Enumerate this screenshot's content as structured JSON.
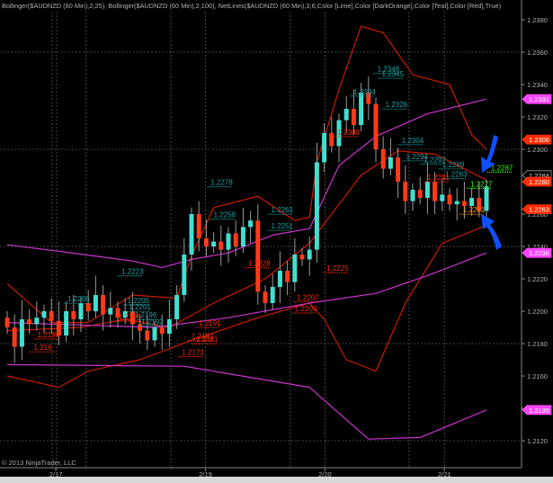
{
  "title": "Bollinger($AUDNZD (60 Min),2,25), Bollinger($AUDNZD (60 Min),2,100), NetLines($AUDNZD (60 Min),3,6,Color [Lime],Color [DarkOrange],Color [Teal],Color [Red],True)",
  "copyright": "© 2013 NinjaTrader, LLC",
  "chart_data": {
    "type": "candlestick",
    "instrument": "$AUDNZD (60 Min)",
    "ylim": [
      1.211,
      1.239
    ],
    "y_ticks": [
      "1.2380",
      "1.2360",
      "1.2340",
      "1.2320",
      "1.2300",
      "1.2280",
      "1.2260",
      "1.2240",
      "1.2220",
      "1.2200",
      "1.2180",
      "1.2160",
      "1.2140",
      "1.2120"
    ],
    "grid_prices": [
      1.236,
      1.23,
      1.224,
      1.218,
      1.212
    ],
    "x_labels": [
      {
        "text": "2/17",
        "bar": 6.6
      },
      {
        "text": "2/19",
        "bar": 26.9
      },
      {
        "text": "2/20",
        "bar": 43.1
      },
      {
        "text": "2/21",
        "bar": 59.3
      }
    ],
    "session_bars": [
      6.1,
      6.7,
      10.7,
      22.2,
      26.9,
      38.4,
      43.1,
      54.5,
      59.3
    ],
    "closes": [
      1.219,
      1.2178,
      1.2195,
      1.2192,
      1.2196,
      1.22,
      1.2194,
      1.2185,
      1.22,
      1.2195,
      1.2205,
      1.22,
      1.221,
      1.2198,
      1.2202,
      1.2196,
      1.22,
      1.2192,
      1.2188,
      1.2182,
      1.219,
      1.2186,
      1.2195,
      1.221,
      1.2235,
      1.226,
      1.2245,
      1.224,
      1.2243,
      1.2238,
      1.2248,
      1.224,
      1.2252,
      1.2256,
      1.2212,
      1.2205,
      1.2215,
      1.2225,
      1.2218,
      1.2235,
      1.2232,
      1.2238,
      1.2292,
      1.231,
      1.2302,
      1.2318,
      1.2325,
      1.2315,
      1.2335,
      1.2328,
      1.23,
      1.2288,
      1.2295,
      1.228,
      1.2268,
      1.2275,
      1.227,
      1.228,
      1.2268,
      1.2272,
      1.2266,
      1.2268,
      1.2265,
      1.227,
      1.2262,
      1.2277
    ],
    "first_open": 1.2196,
    "series": [
      {
        "name": "Bollinger 25 Upper",
        "color": "#cc1a00",
        "points": [
          [
            0,
            1.2217
          ],
          [
            6,
            1.2193
          ],
          [
            11,
            1.2193
          ],
          [
            17,
            1.221
          ],
          [
            23,
            1.2208
          ],
          [
            25,
            1.2234
          ],
          [
            28,
            1.2264
          ],
          [
            34,
            1.2271
          ],
          [
            39,
            1.2256
          ],
          [
            41,
            1.2258
          ],
          [
            42,
            1.2292
          ],
          [
            45,
            1.2337
          ],
          [
            48,
            1.2376
          ],
          [
            51,
            1.2372
          ],
          [
            55,
            1.2346
          ],
          [
            60,
            1.234
          ],
          [
            63,
            1.2309
          ],
          [
            65,
            1.23
          ]
        ]
      },
      {
        "name": "Bollinger 25 Middle",
        "color": "#cc1a00",
        "points": [
          [
            0,
            1.2188
          ],
          [
            10,
            1.219
          ],
          [
            16,
            1.2195
          ],
          [
            22,
            1.219
          ],
          [
            28,
            1.2205
          ],
          [
            35,
            1.222
          ],
          [
            41,
            1.2242
          ],
          [
            48,
            1.2284
          ],
          [
            53,
            1.2299
          ],
          [
            58,
            1.2297
          ],
          [
            65,
            1.2281
          ]
        ]
      },
      {
        "name": "Bollinger 25 Lower",
        "color": "#cc1a00",
        "points": [
          [
            0,
            1.216
          ],
          [
            7,
            1.2153
          ],
          [
            11,
            1.2163
          ],
          [
            18,
            1.217
          ],
          [
            25,
            1.2182
          ],
          [
            34,
            1.2196
          ],
          [
            41,
            1.2205
          ],
          [
            43,
            1.2195
          ],
          [
            46,
            1.217
          ],
          [
            50,
            1.2163
          ],
          [
            54,
            1.2205
          ],
          [
            59,
            1.2242
          ],
          [
            65,
            1.2253
          ]
        ]
      },
      {
        "name": "Bollinger 100 Upper",
        "color": "#cc33cc",
        "points": [
          [
            0,
            1.2241
          ],
          [
            7,
            1.2237
          ],
          [
            17,
            1.2231
          ],
          [
            21,
            1.2227
          ],
          [
            25,
            1.2232
          ],
          [
            30,
            1.2236
          ],
          [
            36,
            1.2247
          ],
          [
            41,
            1.2251
          ],
          [
            45,
            1.229
          ],
          [
            50,
            1.2308
          ],
          [
            57,
            1.2322
          ],
          [
            65,
            1.2331
          ]
        ]
      },
      {
        "name": "Bollinger 100 Middle",
        "color": "#cc33cc",
        "points": [
          [
            0,
            1.2193
          ],
          [
            20,
            1.219
          ],
          [
            30,
            1.2196
          ],
          [
            41,
            1.2205
          ],
          [
            50,
            1.2211
          ],
          [
            57,
            1.2222
          ],
          [
            65,
            1.2236
          ]
        ]
      },
      {
        "name": "Bollinger 100 Lower",
        "color": "#cc33cc",
        "points": [
          [
            0,
            1.2167
          ],
          [
            24,
            1.2166
          ],
          [
            41,
            1.2153
          ],
          [
            49,
            1.2121
          ],
          [
            56,
            1.2122
          ],
          [
            65,
            1.2139
          ]
        ]
      }
    ],
    "net_lines": [
      {
        "text": "1.2348",
        "price": 1.2348,
        "bar": 50.2,
        "color": "#20a0a0"
      },
      {
        "text": "1.2345",
        "price": 1.2345,
        "bar": 50.8,
        "color": "#20a0a0"
      },
      {
        "text": "1.2334",
        "price": 1.2334,
        "bar": 47.0,
        "color": "#20a0a0"
      },
      {
        "text": "1.2326",
        "price": 1.2326,
        "bar": 51.3,
        "color": "#20a0a0"
      },
      {
        "text": "1.2304",
        "price": 1.2304,
        "bar": 53.5,
        "color": "#20a0a0"
      },
      {
        "text": "1.2294",
        "price": 1.2294,
        "bar": 54.1,
        "color": "#20a0a0"
      },
      {
        "text": "1.2292",
        "price": 1.2292,
        "bar": 56.5,
        "color": "#20a0a0"
      },
      {
        "text": "1.2289",
        "price": 1.2289,
        "bar": 59.0,
        "color": "#20a0a0"
      },
      {
        "text": "1.2283",
        "price": 1.2283,
        "bar": 59.4,
        "color": "#20a0a0"
      },
      {
        "text": "1.2278",
        "price": 1.2278,
        "bar": 27.6,
        "color": "#20a0a0"
      },
      {
        "text": "1.2258",
        "price": 1.2258,
        "bar": 28.0,
        "color": "#20a0a0"
      },
      {
        "text": "1.2261",
        "price": 1.2261,
        "bar": 35.8,
        "color": "#20a0a0"
      },
      {
        "text": "1.2251",
        "price": 1.2251,
        "bar": 35.8,
        "color": "#20a0a0"
      },
      {
        "text": "1.2223",
        "price": 1.2223,
        "bar": 15.5,
        "color": "#20a0a0"
      },
      {
        "text": "1.2206",
        "price": 1.2206,
        "bar": 8.2,
        "color": "#20a0a0"
      },
      {
        "text": "1.2205",
        "price": 1.2205,
        "bar": 16.3,
        "color": "#20a0a0"
      },
      {
        "text": "1.2201",
        "price": 1.2201,
        "bar": 16.5,
        "color": "#20a0a0"
      },
      {
        "text": "1.2196",
        "price": 1.2196,
        "bar": 17.3,
        "color": "#20a0a0"
      },
      {
        "text": "1.2192",
        "price": 1.2192,
        "bar": 18.2,
        "color": "#20a0a0"
      },
      {
        "text": "1.2309",
        "price": 1.2309,
        "bar": 44.8,
        "color": "#ff2a00"
      },
      {
        "text": "1.2281",
        "price": 1.2281,
        "bar": 57.0,
        "color": "#ff2a00"
      },
      {
        "text": "1.2228",
        "price": 1.2228,
        "bar": 32.7,
        "color": "#ff2a00"
      },
      {
        "text": "1.2225",
        "price": 1.2225,
        "bar": 43.3,
        "color": "#ff2a00"
      },
      {
        "text": "1.2207",
        "price": 1.2207,
        "bar": 39.3,
        "color": "#ff2a00"
      },
      {
        "text": "1.2200",
        "price": 1.22,
        "bar": 39.0,
        "color": "#ff2a00"
      },
      {
        "text": "1.2195",
        "price": 1.2195,
        "bar": 15.1,
        "color": "#ff2a00"
      },
      {
        "text": "1.2191",
        "price": 1.2191,
        "bar": 26.0,
        "color": "#ff2a00"
      },
      {
        "text": "1.2181",
        "price": 1.2181,
        "bar": 25.6,
        "color": "#ff2a00"
      },
      {
        "text": "1.2183",
        "price": 1.2183,
        "bar": 25.0,
        "color": "#ff2a00"
      },
      {
        "text": "1.2173",
        "price": 1.2173,
        "bar": 23.7,
        "color": "#ff2a00"
      },
      {
        "text": "1.2184",
        "price": 1.2184,
        "bar": 4.1,
        "color": "#ff2a00"
      },
      {
        "text": "1.216",
        "price": 1.2176,
        "bar": 3.6,
        "color": "#ff2a00"
      },
      {
        "text": "1.2261",
        "price": 1.2261,
        "bar": 61.8,
        "color": "#ff8c00"
      },
      {
        "text": "1.2287",
        "price": 1.2287,
        "bar": 65.6,
        "color": "#33ff00"
      },
      {
        "text": "1.2277",
        "price": 1.2277,
        "bar": 62.8,
        "color": "#33ff00"
      }
    ],
    "price_markers": [
      {
        "text": "1.2331",
        "price": 1.2331,
        "bg": "#ff44ff",
        "fg": "#ffffff"
      },
      {
        "text": "1.2306",
        "price": 1.2306,
        "bg": "#ff2a00",
        "fg": "#ffffff"
      },
      {
        "text": "1.2284",
        "price": 1.2284,
        "bg": "#000000",
        "fg": "#cccccc"
      },
      {
        "text": "1.2280",
        "price": 1.228,
        "bg": "#ff2a00",
        "fg": "#ffffff"
      },
      {
        "text": "1.2263",
        "price": 1.2263,
        "bg": "#ff2a00",
        "fg": "#ffffff"
      },
      {
        "text": "1.2236",
        "price": 1.2236,
        "bg": "#ff44ff",
        "fg": "#ffffff"
      },
      {
        "text": "1.2139",
        "price": 1.2139,
        "bg": "#ff44ff",
        "fg": "#ffffff"
      }
    ],
    "colors": {
      "up": "#40e0d0",
      "down": "#ff3a1a",
      "wick": "#9a9a9a",
      "grid": "#555555",
      "axis": "#888888",
      "arrow": "#1050ff"
    }
  }
}
